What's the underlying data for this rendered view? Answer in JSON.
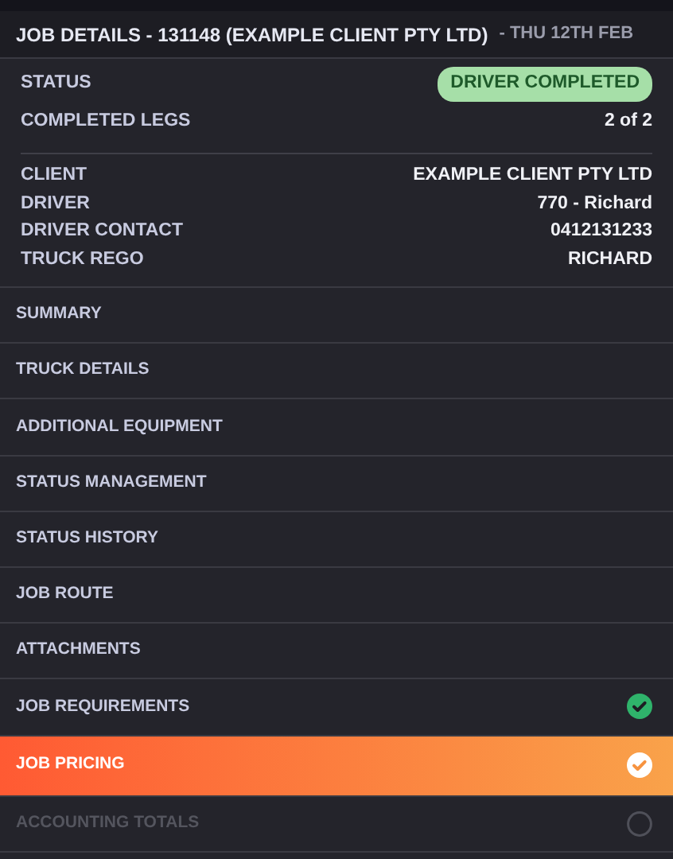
{
  "header": {
    "title": "JOB DETAILS - 131148 (EXAMPLE CLIENT PTY LTD)",
    "date": "- THU 12TH FEB"
  },
  "status": {
    "label": "STATUS",
    "value": "DRIVER COMPLETED"
  },
  "summary_rows": [
    {
      "label": "COMPLETED LEGS",
      "value": "2 of 2"
    }
  ],
  "detail_rows": [
    {
      "label": "CLIENT",
      "value": "EXAMPLE CLIENT PTY LTD"
    },
    {
      "label": "DRIVER",
      "value": "770 - Richard"
    },
    {
      "label": "DRIVER CONTACT",
      "value": "0412131233"
    },
    {
      "label": "TRUCK REGO",
      "value": "RICHARD"
    }
  ],
  "menu": [
    {
      "label": "SUMMARY",
      "selected": false,
      "disabled": false
    },
    {
      "label": "TRUCK DETAILS",
      "selected": false,
      "disabled": false
    },
    {
      "label": "ADDITIONAL EQUIPMENT",
      "selected": false,
      "disabled": false
    },
    {
      "label": "STATUS MANAGEMENT",
      "selected": false,
      "disabled": false
    },
    {
      "label": "STATUS HISTORY",
      "selected": false,
      "disabled": false
    },
    {
      "label": "JOB ROUTE",
      "selected": false,
      "disabled": false
    },
    {
      "label": "ATTACHMENTS",
      "selected": false,
      "disabled": false
    },
    {
      "label": "JOB REQUIREMENTS",
      "selected": false,
      "disabled": false,
      "checked": true
    },
    {
      "label": "JOB PRICING",
      "selected": true,
      "disabled": false,
      "checked": true
    },
    {
      "label": "ACCOUNTING TOTALS",
      "selected": false,
      "disabled": true,
      "checked": false
    }
  ]
}
